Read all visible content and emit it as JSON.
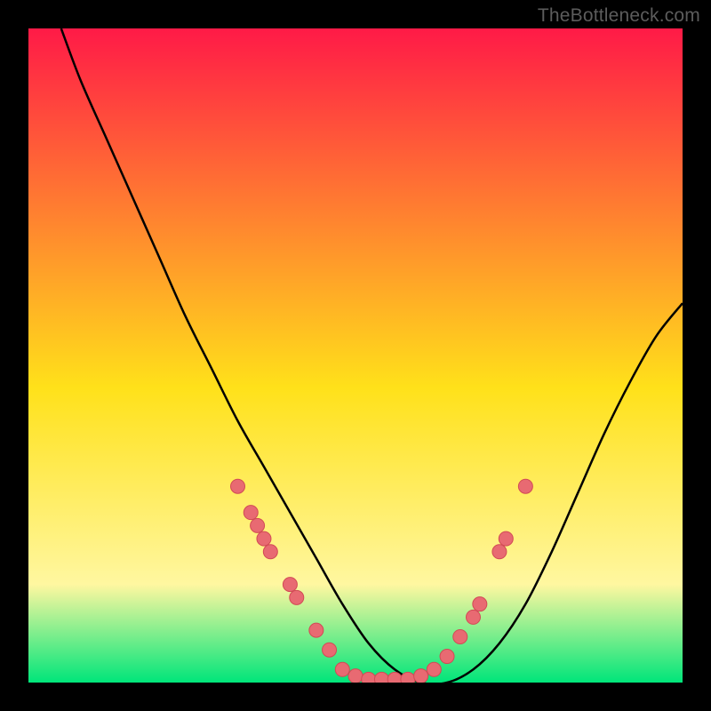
{
  "watermark": "TheBottleneck.com",
  "chart_data": {
    "type": "line",
    "title": "",
    "xlabel": "",
    "ylabel": "",
    "xlim": [
      0,
      100
    ],
    "ylim": [
      0,
      100
    ],
    "grid": false,
    "background_gradient": {
      "top": "#ff1a47",
      "mid1": "#ffe11a",
      "mid2": "#fff7a0",
      "bottom": "#00e57a"
    },
    "series": [
      {
        "name": "curve",
        "color": "#000000",
        "x": [
          5,
          8,
          12,
          16,
          20,
          24,
          28,
          32,
          36,
          40,
          44,
          48,
          52,
          56,
          60,
          64,
          68,
          72,
          76,
          80,
          84,
          88,
          92,
          96,
          100
        ],
        "y": [
          100,
          92,
          83,
          74,
          65,
          56,
          48,
          40,
          33,
          26,
          19,
          12,
          6,
          2,
          0,
          0,
          2,
          6,
          12,
          20,
          29,
          38,
          46,
          53,
          58
        ]
      }
    ],
    "markers": [
      {
        "x": 32,
        "y": 30
      },
      {
        "x": 34,
        "y": 26
      },
      {
        "x": 35,
        "y": 24
      },
      {
        "x": 36,
        "y": 22
      },
      {
        "x": 37,
        "y": 20
      },
      {
        "x": 40,
        "y": 15
      },
      {
        "x": 41,
        "y": 13
      },
      {
        "x": 44,
        "y": 8
      },
      {
        "x": 46,
        "y": 5
      },
      {
        "x": 48,
        "y": 2
      },
      {
        "x": 50,
        "y": 1
      },
      {
        "x": 52,
        "y": 0.5
      },
      {
        "x": 54,
        "y": 0.5
      },
      {
        "x": 56,
        "y": 0.5
      },
      {
        "x": 58,
        "y": 0.5
      },
      {
        "x": 60,
        "y": 1
      },
      {
        "x": 62,
        "y": 2
      },
      {
        "x": 64,
        "y": 4
      },
      {
        "x": 66,
        "y": 7
      },
      {
        "x": 68,
        "y": 10
      },
      {
        "x": 69,
        "y": 12
      },
      {
        "x": 72,
        "y": 20
      },
      {
        "x": 73,
        "y": 22
      },
      {
        "x": 76,
        "y": 30
      }
    ],
    "marker_style": {
      "fill": "#e86a72",
      "stroke": "#d24a55",
      "radius_px": 8
    }
  }
}
